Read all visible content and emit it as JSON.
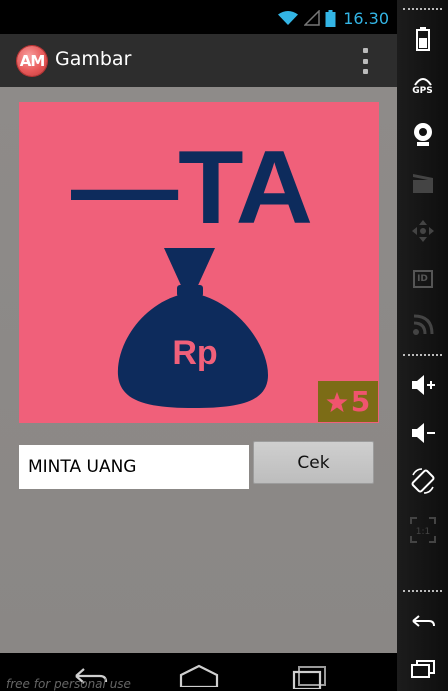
{
  "status_bar": {
    "time": "16.30",
    "icons": [
      "wifi-icon",
      "signal-icon",
      "battery-icon"
    ],
    "accent_color": "#33b5e5"
  },
  "action_bar": {
    "app_icon_text": "AM",
    "title": "Gambar",
    "menu_icon": "overflow-menu-icon"
  },
  "puzzle": {
    "image_text": "—TA",
    "money_bag_label": "Rp",
    "image_background": "#f0607a",
    "foreground_color": "#0d2b5c",
    "level_badge": {
      "icon": "star-icon",
      "value": "5",
      "badge_color": "#7c6c16"
    }
  },
  "answer": {
    "value": "MINTA UANG",
    "check_label": "Cek"
  },
  "nav_bar": {
    "icons": [
      "back-icon",
      "home-icon",
      "recents-icon"
    ],
    "watermark": "free for personal use"
  },
  "emulator_panel": {
    "gps_label": "GPS",
    "id_label": "ID",
    "scale_label": "1:1",
    "icons": [
      "battery-icon",
      "gps-icon",
      "camera-icon",
      "video-icon",
      "dpad-icon",
      "id-icon",
      "network-icon",
      "volume-up-icon",
      "volume-down-icon",
      "rotate-icon",
      "scale-icon",
      "back-icon",
      "recents-icon"
    ]
  }
}
